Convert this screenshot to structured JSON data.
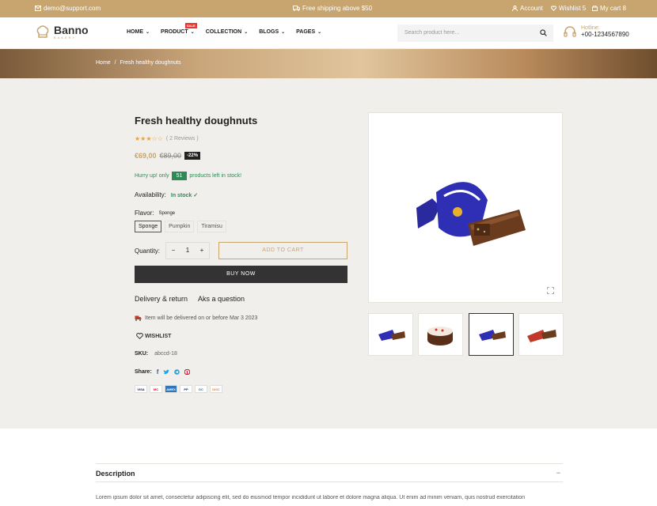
{
  "topbar": {
    "email": "demo@support.com",
    "shipping": "Free shipping above $50",
    "account": "Account",
    "wishlist": "Wishlist 5",
    "cart": "My cart 8"
  },
  "header": {
    "logo_name": "Banno",
    "logo_sub": "BAKERY",
    "nav": [
      "HOME",
      "PRODUCT",
      "COLLECTION",
      "BLOGS",
      "PAGES"
    ],
    "sale_badge": "SALE",
    "search_placeholder": "Search product here...",
    "hotline_label": "Hotline:",
    "hotline_number": "+00-1234567890"
  },
  "breadcrumb": {
    "home": "Home",
    "sep": "/",
    "current": "Fresh healthy doughnuts"
  },
  "product": {
    "title": "Fresh healthy doughnuts",
    "rating": 3,
    "rating_max": 5,
    "reviews": "( 2 Reviews )",
    "price_new": "€69,00",
    "price_old": "€89,00",
    "discount": "-22%",
    "hurry_pre": "Hurry up! only",
    "stock_count": "51",
    "hurry_post": "products left in stock!",
    "availability_label": "Availability:",
    "availability_value": "In stock",
    "flavor_label": "Flavor:",
    "flavor_selected": "Sponge",
    "flavors": [
      "Sponge",
      "Pumpkin",
      "Tiramisu"
    ],
    "quantity_label": "Quantity:",
    "quantity": "1",
    "minus": "−",
    "plus": "+",
    "add_to_cart": "ADD TO CART",
    "buy_now": "BUY NOW",
    "delivery_link": "Delivery & return",
    "ask_link": "Aks a question",
    "delivery_note": "Item will be delivered on or before Mar 3 2023",
    "wishlist": "WISHLIST",
    "sku_label": "SKU:",
    "sku_value": "abccd-18",
    "share_label": "Share:",
    "payments": [
      "VISA",
      "MC",
      "AMEX",
      "PP",
      "DC",
      "DISC"
    ]
  },
  "description": {
    "title": "Description",
    "toggle": "−",
    "text": "Lorem ipsum dolor sit amet, consectetur adipiscing elit, sed do eiusmod tempor incididunt ut labore et dolore magna aliqua. Ut enim ad minim veniam, quis nostrud exercitation"
  },
  "colors": {
    "accent": "#c8a56f",
    "dark": "#333333",
    "green": "#2e8b57",
    "bg": "#f1efeb"
  }
}
